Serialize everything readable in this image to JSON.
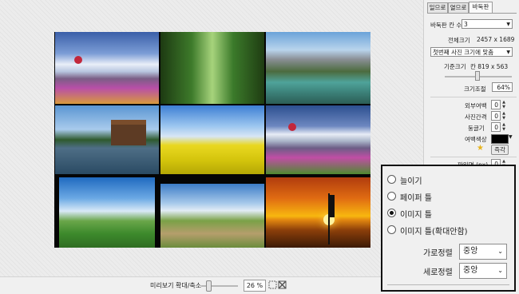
{
  "preview": {
    "zoom_label": "미리보기 확대/축소",
    "zoom_value": "26 %",
    "zoom_level_percent": 26
  },
  "panel": {
    "tabs": [
      "일므로",
      "열므로",
      "바둑판"
    ],
    "active_tab": "바둑판",
    "grid_count_label": "바둑판 칸 수",
    "grid_count_value": "3",
    "total_size_label": "전체크기",
    "total_size_value": "2457 x 1689",
    "fit_option_value": "첫번째 사진 크기에 맞춤",
    "base_size_label": "기준크기",
    "base_size_value": "칸 819 x 563",
    "base_size_slider_fraction": 0.5,
    "scale_label": "크기조절",
    "scale_value": "64%",
    "outer_margin_label": "외부여백",
    "outer_margin_value": "0",
    "photo_gap_label": "사진간격",
    "photo_gap_value": "0",
    "round_label": "둥글기",
    "round_value": "0",
    "margin_color_label": "여백색상",
    "margin_color": "#000000",
    "favorites_button": "즉각",
    "file_label": "파일명 (px)",
    "file_value": "0"
  },
  "popup": {
    "options": [
      {
        "label": "늘이기",
        "checked": false
      },
      {
        "label": "페이퍼 틀",
        "checked": false
      },
      {
        "label": "이미지 틀",
        "checked": true
      },
      {
        "label": "이미지 틀(확대안함)",
        "checked": false
      }
    ],
    "h_align_label": "가로정렬",
    "h_align_value": "중앙",
    "v_align_label": "세로정렬",
    "v_align_value": "중앙"
  },
  "colors": {
    "star": "#e7b41d",
    "collage_background": "#050505"
  }
}
